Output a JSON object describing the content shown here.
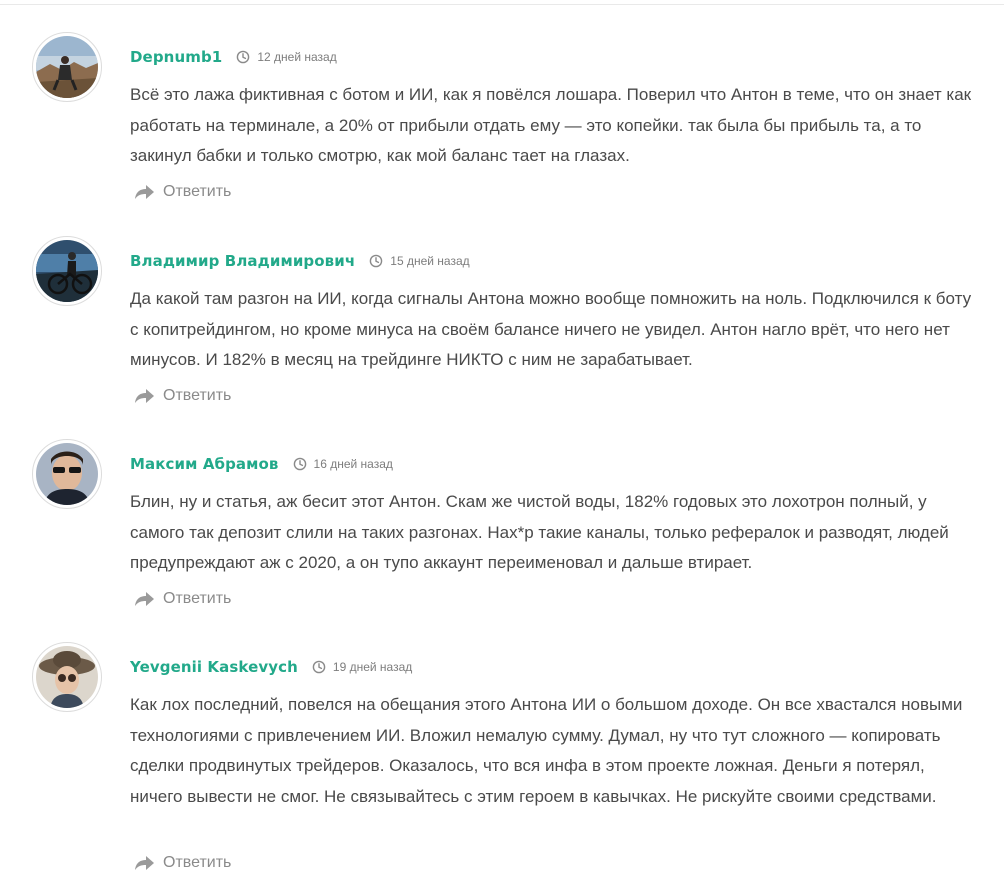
{
  "reply_label": "Ответить",
  "icons": {
    "clock": "clock-icon",
    "reply": "reply-arrow-icon"
  },
  "colors": {
    "author": "#22a98a",
    "text": "#4a4a4a",
    "muted": "#8a8a8a"
  },
  "comments": [
    {
      "author": "Depnumb1",
      "date": "12 дней назад",
      "text": "Всё это лажа фиктивная с ботом и ИИ, как я повёлся лошара. Поверил что Антон в теме, что он знает как работать на терминале, а 20% от прибыли отдать ему — это копейки. так была бы прибыль та, а то закинул бабки и только смотрю, как мой баланс тает на глазах."
    },
    {
      "author": "Владимир Владимирович",
      "date": "15 дней назад",
      "text": "Да какой там разгон на ИИ, когда сигналы Антона можно вообще помножить на ноль. Подключился к боту с копитрейдингом, но кроме минуса на своём балансе ничего не увидел. Антон нагло врёт, что него нет минусов. И 182% в месяц на трейдинге НИКТО с ним не зарабатывает."
    },
    {
      "author": "Максим Абрамов",
      "date": "16 дней назад",
      "text": "Блин, ну и статья, аж бесит этот Антон. Скам же чистой воды, 182% годовых это лохотрон полный, у самого так депозит слили на таких разгонах. Нах*р такие каналы, только рефералок и разводят, людей предупреждают аж с 2020, а он тупо аккаунт переименовал и дальше втирает."
    },
    {
      "author": "Yevgenii Kaskevych",
      "date": "19 дней назад",
      "text": "Как лох последний, повелся на обещания этого Антона ИИ о большом доходе. Он все хвастался новыми технологиями с привлечением ИИ. Вложил немалую сумму. Думал, ну что тут сложного — копировать сделки продвинутых трейдеров. Оказалось, что вся инфа в этом проекте ложная. Деньги я потерял, ничего вывести не смог. Не связывайтесь с этим героем в кавычках. Не рискуйте своими средствами."
    }
  ]
}
